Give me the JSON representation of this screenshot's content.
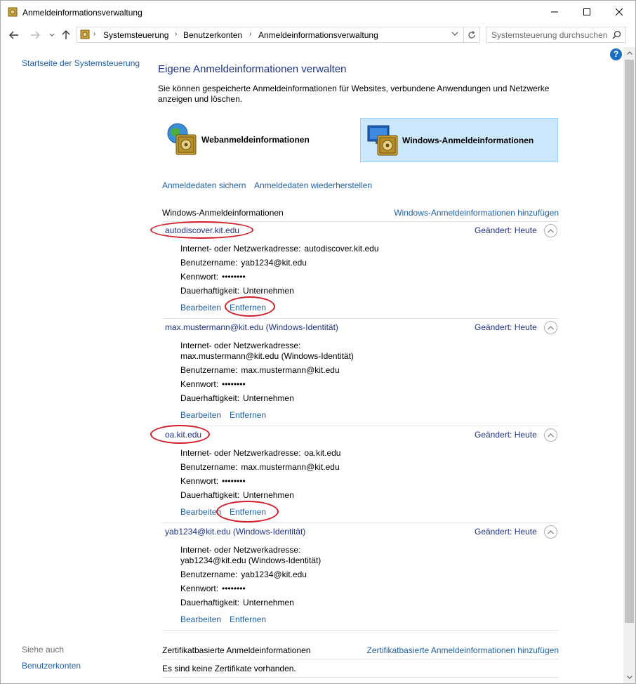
{
  "window": {
    "title": "Anmeldeinformationsverwaltung"
  },
  "address": {
    "crumbs": [
      "Systemsteuerung",
      "Benutzerkonten",
      "Anmeldeinformationsverwaltung"
    ],
    "search_placeholder": "Systemsteuerung durchsuchen"
  },
  "help": {
    "label": "?"
  },
  "sidebar": {
    "home": "Startseite der Systemsteuerung",
    "see_also": "Siehe auch",
    "accounts": "Benutzerkonten"
  },
  "main": {
    "heading": "Eigene Anmeldeinformationen verwalten",
    "intro": "Sie können gespeicherte Anmeldeinformationen für Websites, verbundene Anwendungen und Netzwerke anzeigen und löschen.",
    "tiles": {
      "web": "Webanmeldeinformationen",
      "windows": "Windows-Anmeldeinformationen"
    },
    "backup": "Anmeldedaten sichern",
    "restore": "Anmeldedaten wiederherstellen",
    "windows_section": {
      "title": "Windows-Anmeldeinformationen",
      "add": "Windows-Anmeldeinformationen hinzufügen"
    },
    "labels": {
      "address": "Internet- oder Netzwerkadresse:",
      "user": "Benutzername:",
      "password": "Kennwort:",
      "persistence": "Dauerhaftigkeit:",
      "changed": "Geändert:",
      "edit": "Bearbeiten",
      "remove": "Entfernen"
    },
    "credentials": [
      {
        "name": "autodiscover.kit.edu",
        "changed": "Heute",
        "address": "autodiscover.kit.edu",
        "user": "yab1234@kit.edu",
        "password": "••••••••",
        "persistence": "Unternehmen"
      },
      {
        "name": "max.mustermann@kit.edu (Windows-Identität)",
        "changed": "Heute",
        "address": "max.mustermann@kit.edu (Windows-Identität)",
        "user": "max.mustermann@kit.edu",
        "password": "••••••••",
        "persistence": "Unternehmen"
      },
      {
        "name": "oa.kit.edu",
        "changed": "Heute",
        "address": "oa.kit.edu",
        "user": "max.mustermann@kit.edu",
        "password": "••••••••",
        "persistence": "Unternehmen"
      },
      {
        "name": "yab1234@kit.edu (Windows-Identität)",
        "changed": "Heute",
        "address": "yab1234@kit.edu (Windows-Identität)",
        "user": "yab1234@kit.edu",
        "password": "••••••••",
        "persistence": "Unternehmen"
      }
    ],
    "cert_section": {
      "title": "Zertifikatbasierte Anmeldeinformationen",
      "add": "Zertifikatbasierte Anmeldeinformationen hinzufügen",
      "empty": "Es sind keine Zertifikate vorhanden."
    }
  },
  "colors": {
    "link": "#1f5fa8",
    "heading": "#1e3287",
    "selected_tile": "#cce8ff",
    "annotation": "#d01f2a"
  }
}
